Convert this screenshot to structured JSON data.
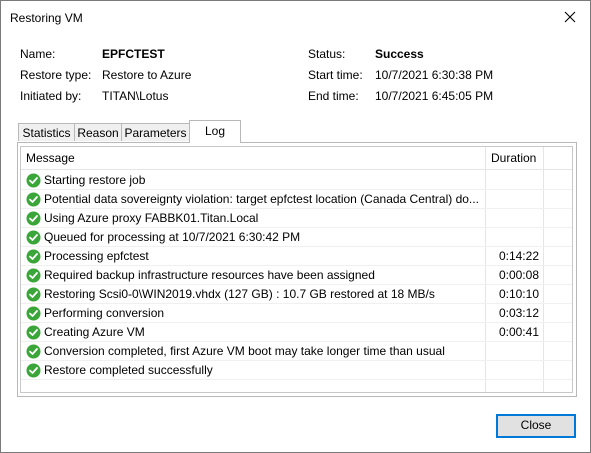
{
  "window": {
    "title": "Restoring VM"
  },
  "info": {
    "name_label": "Name:",
    "name_value": "EPFCTEST",
    "restore_type_label": "Restore type:",
    "restore_type_value": "Restore to Azure",
    "initiated_by_label": "Initiated by:",
    "initiated_by_value": "TITAN\\Lotus",
    "status_label": "Status:",
    "status_value": "Success",
    "start_time_label": "Start time:",
    "start_time_value": "10/7/2021 6:30:38 PM",
    "end_time_label": "End time:",
    "end_time_value": "10/7/2021 6:45:05 PM"
  },
  "tabs": [
    {
      "label": "Statistics"
    },
    {
      "label": "Reason"
    },
    {
      "label": "Parameters"
    },
    {
      "label": "Log",
      "active": true
    }
  ],
  "log": {
    "columns": {
      "message": "Message",
      "duration": "Duration"
    },
    "rows": [
      {
        "message": "Starting restore job",
        "duration": ""
      },
      {
        "message": "Potential data sovereignty violation: target epfctest location (Canada Central) do...",
        "duration": ""
      },
      {
        "message": "Using Azure proxy FABBK01.Titan.Local",
        "duration": ""
      },
      {
        "message": "Queued for processing at 10/7/2021 6:30:42 PM",
        "duration": ""
      },
      {
        "message": "Processing epfctest",
        "duration": "0:14:22"
      },
      {
        "message": "Required backup infrastructure resources have been assigned",
        "duration": "0:00:08"
      },
      {
        "message": "Restoring Scsi0-0\\WIN2019.vhdx (127 GB) : 10.7 GB restored at 18 MB/s",
        "duration": "0:10:10"
      },
      {
        "message": "Performing conversion",
        "duration": "0:03:12"
      },
      {
        "message": "Creating Azure VM",
        "duration": "0:00:41"
      },
      {
        "message": "Conversion completed, first Azure VM boot may take longer time than usual",
        "duration": ""
      },
      {
        "message": "Restore completed successfully",
        "duration": ""
      }
    ],
    "row_icon": "success-check-icon"
  },
  "buttons": {
    "close_label": "Close"
  },
  "colors": {
    "success_green": "#3aa639",
    "accent_blue": "#0078d7"
  }
}
